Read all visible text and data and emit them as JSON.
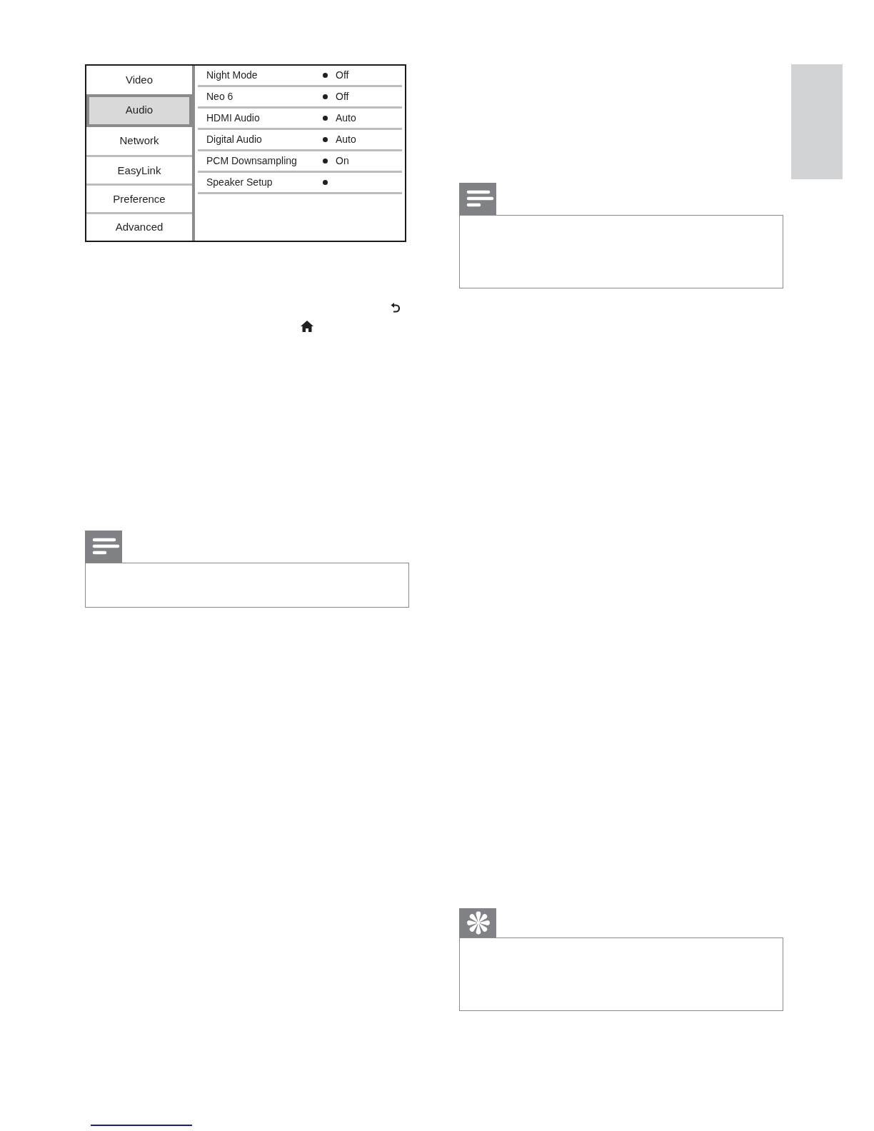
{
  "left_column": {
    "settings_menu": {
      "categories": [
        {
          "label": "Video",
          "selected": false
        },
        {
          "label": "Audio",
          "selected": true
        },
        {
          "label": "Network",
          "selected": false
        },
        {
          "label": "EasyLink",
          "selected": false
        },
        {
          "label": "Preference",
          "selected": false
        },
        {
          "label": "Advanced",
          "selected": false
        }
      ],
      "options": [
        {
          "label": "Night Mode",
          "value": "Off"
        },
        {
          "label": "Neo 6",
          "value": "Off"
        },
        {
          "label": "HDMI Audio",
          "value": "Auto"
        },
        {
          "label": "Digital Audio",
          "value": "Auto"
        },
        {
          "label": "PCM Downsampling",
          "value": "On"
        },
        {
          "label": "Speaker Setup"
        }
      ]
    },
    "callouts": [
      {
        "kind": "note"
      }
    ]
  },
  "right_column": {
    "callouts": [
      {
        "kind": "note"
      },
      {
        "kind": "tip"
      }
    ]
  }
}
